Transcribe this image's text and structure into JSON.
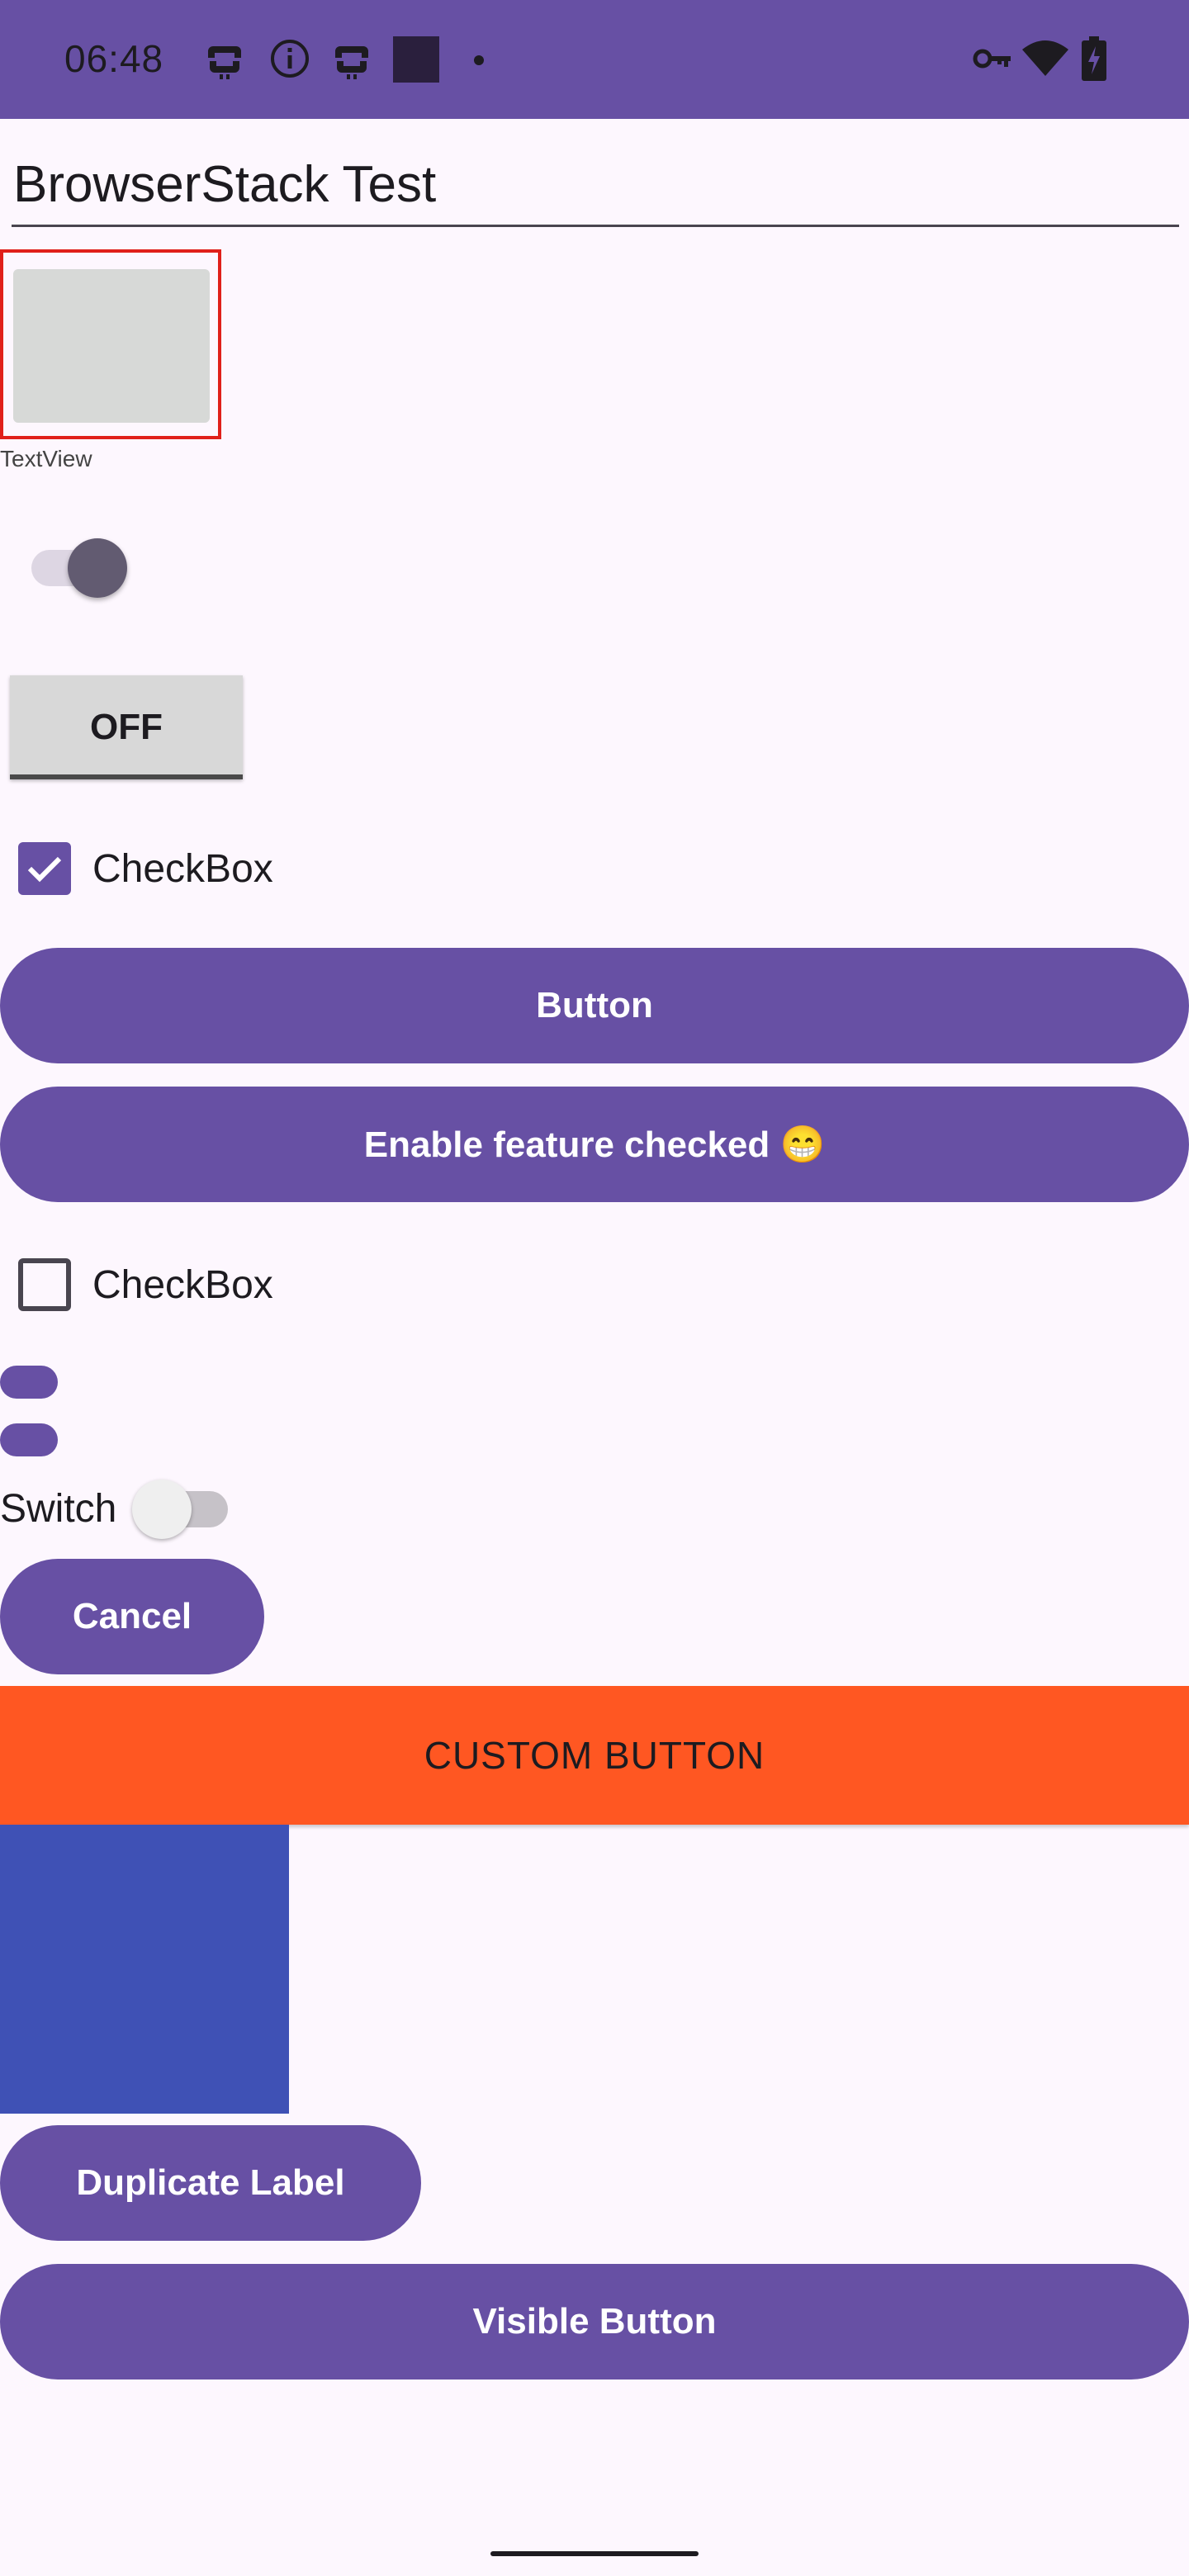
{
  "status_bar": {
    "time": "06:48",
    "left_icons": [
      "robot-icon",
      "info-icon",
      "robot-icon",
      "square-app-icon",
      "dot-icon"
    ],
    "right_icons": [
      "vpn-key-icon",
      "wifi-icon",
      "battery-charging-icon"
    ]
  },
  "text_input": {
    "value": "BrowserStack Test"
  },
  "image_caption": "TextView",
  "toggle_switch": {
    "checked": true
  },
  "toggle_button": {
    "label": "OFF"
  },
  "checkbox_1": {
    "label": "CheckBox",
    "checked": true
  },
  "button": {
    "label": "Button"
  },
  "enable_feature_button": {
    "label": "Enable feature checked 😁"
  },
  "checkbox_2": {
    "label": "CheckBox",
    "checked": false
  },
  "switch": {
    "label": "Switch",
    "checked": false
  },
  "cancel_button": {
    "label": "Cancel"
  },
  "custom_button": {
    "label": "CUSTOM BUTTON"
  },
  "duplicate_label_button": {
    "label": "Duplicate Label"
  },
  "visible_button": {
    "label": "Visible Button"
  },
  "colors": {
    "primary": "#6750a4",
    "background": "#fdf7fe",
    "custom_button": "#ff5722",
    "blue_block": "#3f51b5",
    "image_border": "#e0201a"
  }
}
